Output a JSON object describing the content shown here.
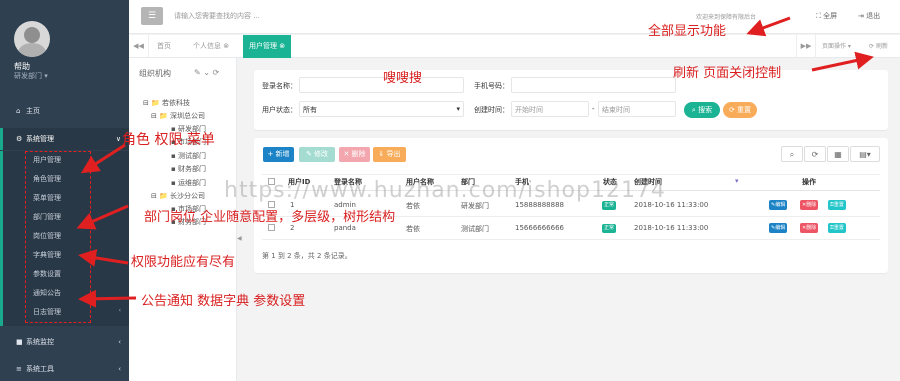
{
  "user": {
    "name": "帮助",
    "dept": "研发部门 ▾"
  },
  "sidebar": {
    "home": "主页",
    "system": "系统管理",
    "monitor": "系统监控",
    "tools": "系统工具",
    "sub": [
      "用户管理",
      "角色管理",
      "菜单管理",
      "部门管理",
      "岗位管理",
      "字典管理",
      "参数设置",
      "通知公告",
      "日志管理"
    ]
  },
  "header": {
    "search_placeholder": "请输入您需要查找的内容 ...",
    "welcome": "欢迎来到保障有限后台",
    "fullscreen": "全屏",
    "logout": "退出"
  },
  "tabs": {
    "items": [
      "首页",
      "个人信息",
      "用户管理"
    ],
    "page_ops": "页面操作 ▾",
    "refresh": "刷新"
  },
  "org": {
    "title": "组织机构",
    "tree": [
      "若依科技",
      "深圳总公司",
      "研发部门",
      "市场部门",
      "测试部门",
      "财务部门",
      "运维部门",
      "长沙分公司",
      "市场部门",
      "财务部门"
    ]
  },
  "filter": {
    "login_name_label": "登录名称：",
    "phone_label": "手机号码：",
    "status_label": "用户状态：",
    "status_value": "所有",
    "time_label": "创建时间：",
    "start_time": "开始时间",
    "end_time": "结束时间",
    "dash": "-",
    "search_btn": "搜索",
    "reset_btn": "重置"
  },
  "toolbar": {
    "add": "新增",
    "edit": "修改",
    "delete": "删除",
    "export": "导出"
  },
  "table": {
    "headers": [
      "用户ID",
      "登录名称",
      "用户名称",
      "部门",
      "手机",
      "状态",
      "创建时间",
      "操作"
    ],
    "rows": [
      {
        "id": "1",
        "login": "admin",
        "name": "若依",
        "dept": "研发部门",
        "phone": "15888888888",
        "status": "正常",
        "created": "2018-10-16 11:33:00"
      },
      {
        "id": "2",
        "login": "panda",
        "name": "若依",
        "dept": "测试部门",
        "phone": "15666666666",
        "status": "正常",
        "created": "2018-10-16 11:33:00"
      }
    ],
    "actions": [
      "编辑",
      "删除",
      "重置"
    ],
    "pageinfo": "第 1 到 2 条，共 2 条记录。"
  },
  "annotations": {
    "fullscreen": "全部显示功能",
    "search": "嗖嗖搜",
    "refresh": "刷新 页面关闭控制",
    "role": "角色 权限 菜单",
    "dept": "部门岗位 企业随意配置，多层级，树形结构",
    "perm": "权限功能应有尽有",
    "notice": "公告通知 数据字典 参数设置"
  },
  "watermark": "https://www.huzhan.com/ishop12174",
  "colors": {
    "sidebar": "#2f4050",
    "accent": "#1ab394",
    "primary": "#1c84c6",
    "danger": "#ed5565",
    "warning": "#f8ac59",
    "annotation": "#d91f1f"
  }
}
